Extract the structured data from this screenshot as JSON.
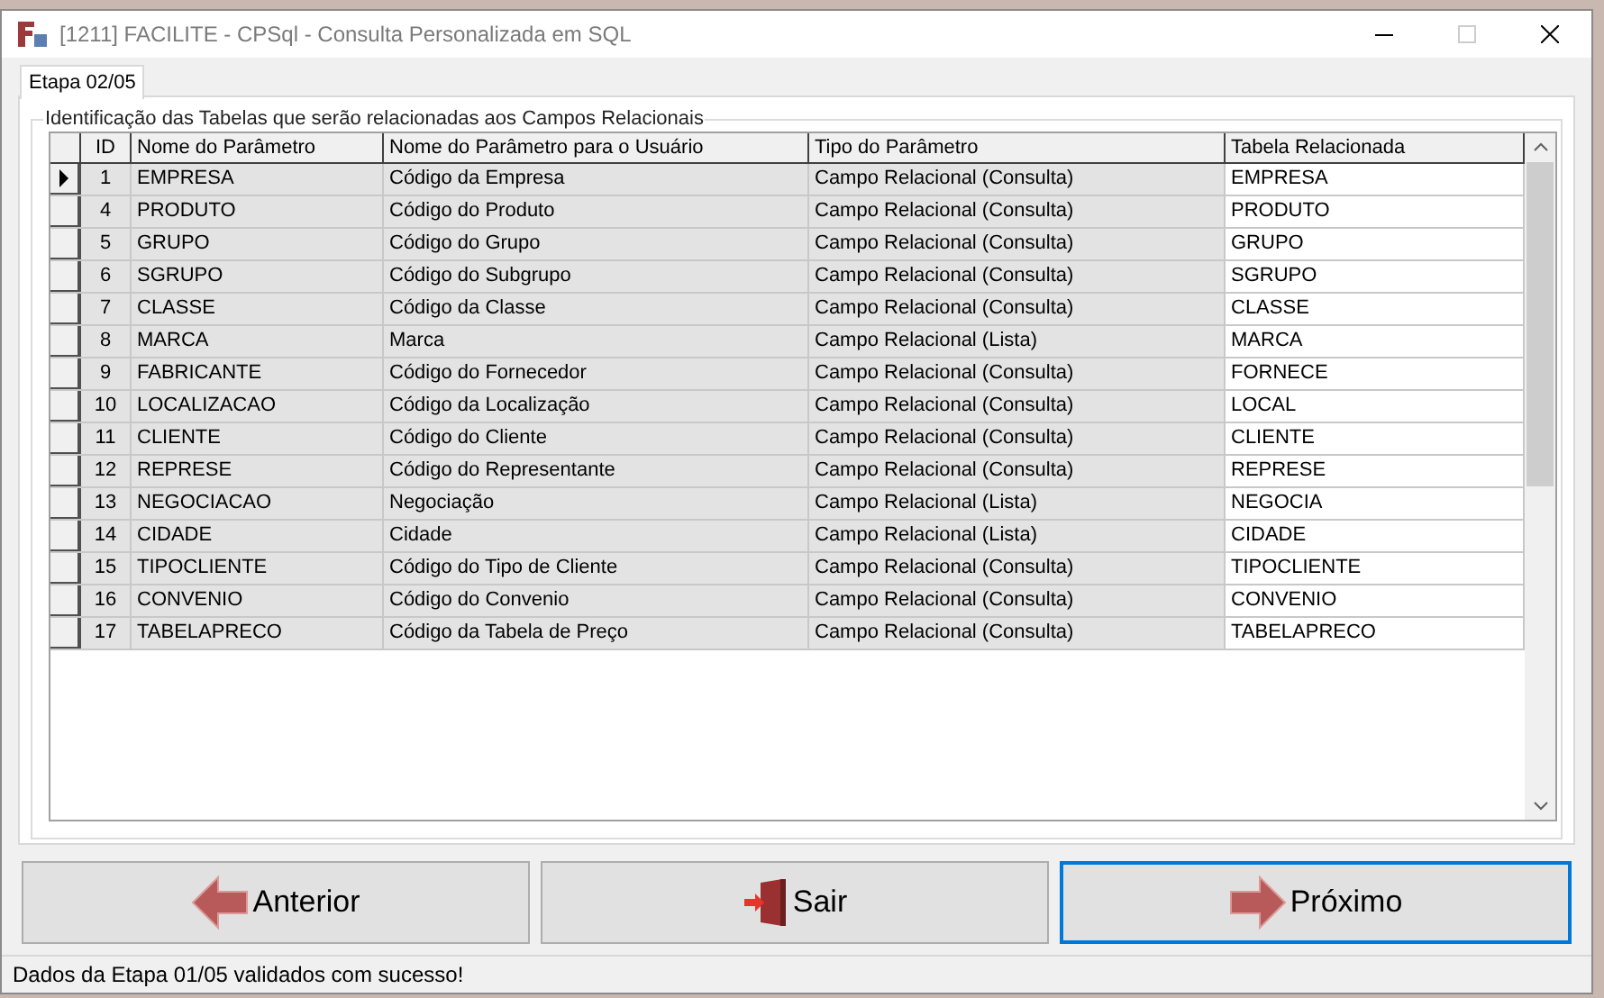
{
  "window": {
    "title": "[1211] FACILITE - CPSql - Consulta Personalizada em SQL"
  },
  "tabs": [
    {
      "label": "Etapa 02/05",
      "selected": true
    }
  ],
  "group": {
    "legend": "Identificação das Tabelas que serão relacionadas aos Campos Relacionais"
  },
  "table": {
    "columns": [
      "ID",
      "Nome do Parâmetro",
      "Nome do Parâmetro para o Usuário",
      "Tipo do Parâmetro",
      "Tabela Relacionada"
    ],
    "rows": [
      {
        "cells": [
          "1",
          "EMPRESA",
          "Código da Empresa",
          "Campo Relacional (Consulta)",
          "EMPRESA"
        ],
        "selected": true
      },
      {
        "cells": [
          "4",
          "PRODUTO",
          "Código do Produto",
          "Campo Relacional (Consulta)",
          "PRODUTO"
        ],
        "selected": false
      },
      {
        "cells": [
          "5",
          "GRUPO",
          "Código do Grupo",
          "Campo Relacional (Consulta)",
          "GRUPO"
        ],
        "selected": false
      },
      {
        "cells": [
          "6",
          "SGRUPO",
          "Código do Subgrupo",
          "Campo Relacional (Consulta)",
          "SGRUPO"
        ],
        "selected": false
      },
      {
        "cells": [
          "7",
          "CLASSE",
          "Código da Classe",
          "Campo Relacional (Consulta)",
          "CLASSE"
        ],
        "selected": false
      },
      {
        "cells": [
          "8",
          "MARCA",
          "Marca",
          "Campo Relacional (Lista)",
          "MARCA"
        ],
        "selected": false
      },
      {
        "cells": [
          "9",
          "FABRICANTE",
          "Código do Fornecedor",
          "Campo Relacional (Consulta)",
          "FORNECE"
        ],
        "selected": false
      },
      {
        "cells": [
          "10",
          "LOCALIZACAO",
          "Código da Localização",
          "Campo Relacional (Consulta)",
          "LOCAL"
        ],
        "selected": false
      },
      {
        "cells": [
          "11",
          "CLIENTE",
          "Código do Cliente",
          "Campo Relacional (Consulta)",
          "CLIENTE"
        ],
        "selected": false
      },
      {
        "cells": [
          "12",
          "REPRESE",
          "Código do Representante",
          "Campo Relacional (Consulta)",
          "REPRESE"
        ],
        "selected": false
      },
      {
        "cells": [
          "13",
          "NEGOCIACAO",
          "Negociação",
          "Campo Relacional (Lista)",
          "NEGOCIA"
        ],
        "selected": false
      },
      {
        "cells": [
          "14",
          "CIDADE",
          "Cidade",
          "Campo Relacional (Lista)",
          "CIDADE"
        ],
        "selected": false
      },
      {
        "cells": [
          "15",
          "TIPOCLIENTE",
          "Código do Tipo de Cliente",
          "Campo Relacional (Consulta)",
          "TIPOCLIENTE"
        ],
        "selected": false
      },
      {
        "cells": [
          "16",
          "CONVENIO",
          "Código do Convenio",
          "Campo Relacional (Consulta)",
          "CONVENIO"
        ],
        "selected": false
      },
      {
        "cells": [
          "17",
          "TABELAPRECO",
          "Código da Tabela de Preço",
          "Campo Relacional (Consulta)",
          "TABELAPRECO"
        ],
        "selected": false
      }
    ]
  },
  "buttons": [
    {
      "label": "Anterior",
      "kind": "back",
      "focused": false
    },
    {
      "label": "Sair",
      "kind": "exit",
      "focused": false
    },
    {
      "label": "Próximo",
      "kind": "next",
      "focused": true
    }
  ],
  "status_bar": {
    "text": "Dados da Etapa 01/05 validados com sucesso!"
  }
}
